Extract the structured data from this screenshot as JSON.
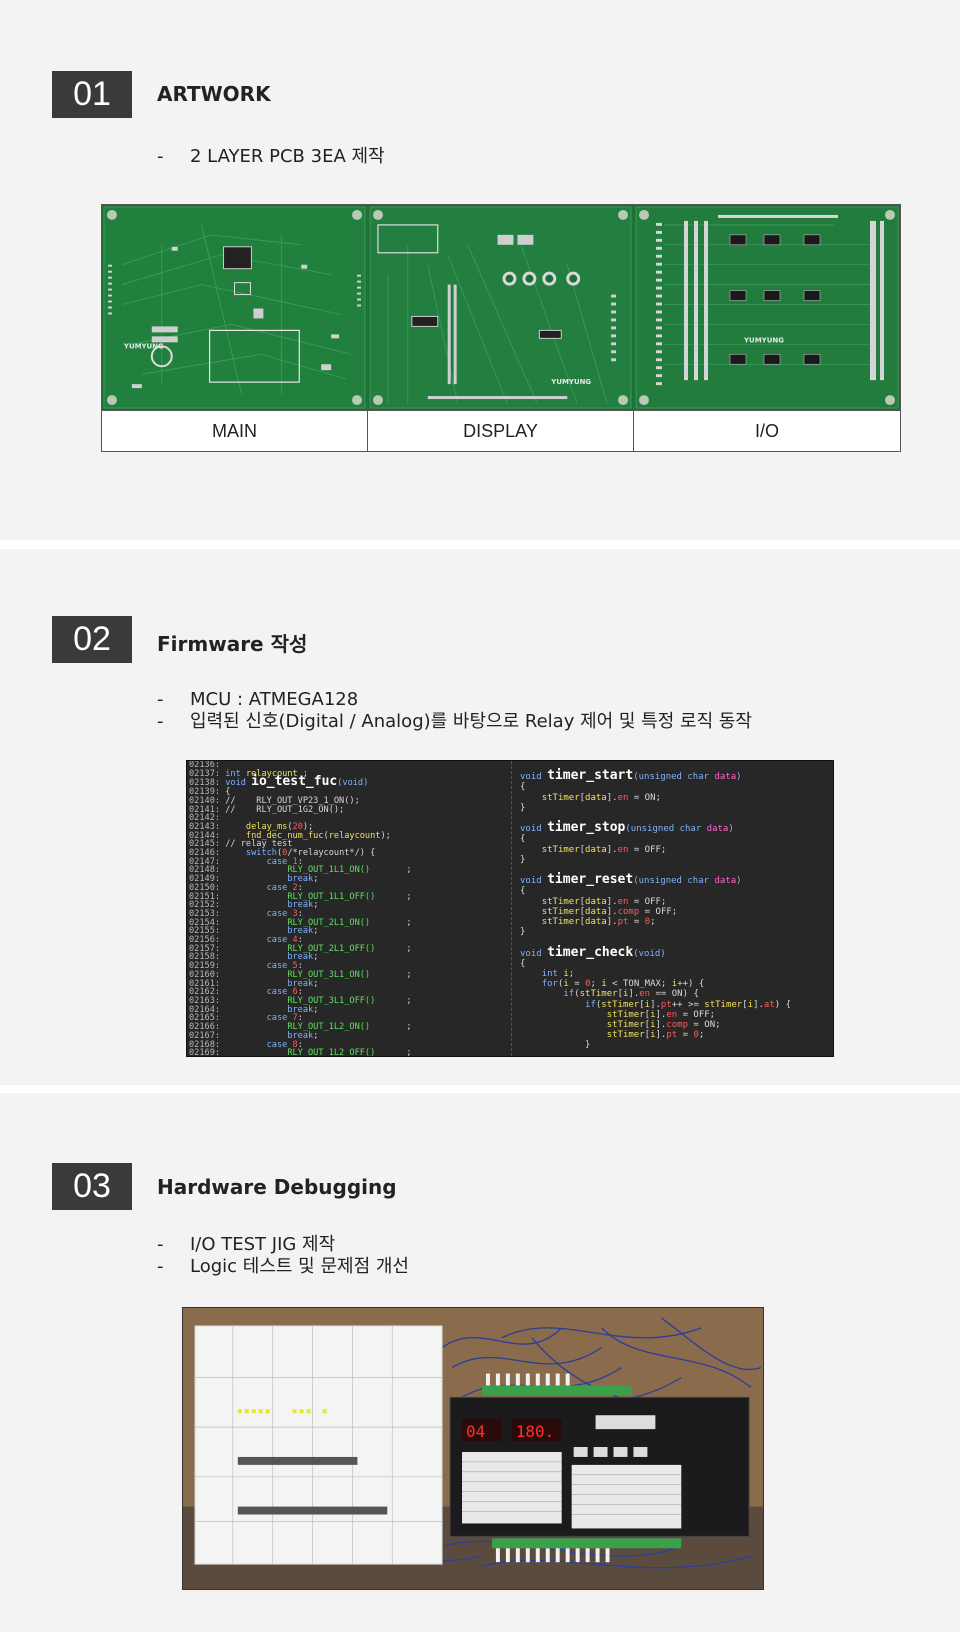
{
  "sections": [
    {
      "number": "01",
      "title": "ARTWORK",
      "bullets": [
        "2 LAYER PCB 3EA 제작"
      ],
      "boards": [
        {
          "label": "MAIN"
        },
        {
          "label": "DISPLAY"
        },
        {
          "label": "I/O"
        }
      ]
    },
    {
      "number": "02",
      "title": "Firmware  작성",
      "bullets": [
        "MCU : ATMEGA128",
        "입력된 신호(Digital / Analog)를 바탕으로 Relay 제어 및 특정 로직 동작"
      ]
    },
    {
      "number": "03",
      "title": "Hardware  Debugging",
      "bullets": [
        "I/O TEST JIG 제작",
        "Logic 테스트 및 문제점 개선"
      ]
    }
  ],
  "bullet_dash": "-",
  "colors": {
    "section_bg": "#f3f3f3",
    "number_box": "#3a3a3a",
    "pcb_green": "#1f7a3a",
    "code_bg": "#272727"
  }
}
